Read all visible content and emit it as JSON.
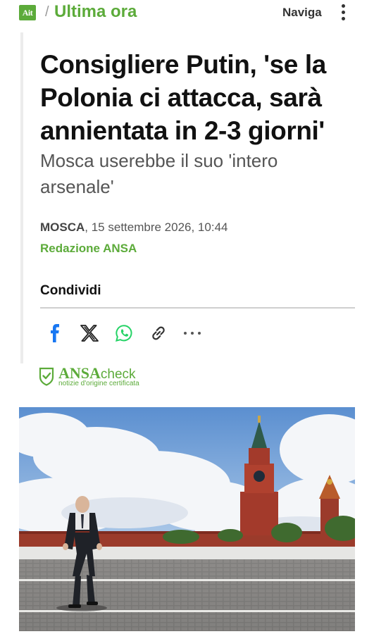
{
  "header": {
    "logo_text": "Ait",
    "separator": "/",
    "section": "Ultima ora",
    "nav_label": "Naviga",
    "menu_icon": "kebab-menu-icon"
  },
  "article": {
    "headline": "Consigliere Putin, 'se la Polonia ci attacca, sarà annientata in 2-3 giorni'",
    "subtitle": "Mosca userebbe il suo 'intero arsenale'",
    "location": "MOSCA",
    "date": ", 15 settembre 2026, 10:44",
    "byline": "Redazione ANSA"
  },
  "share": {
    "label": "Condividi",
    "icons": [
      "facebook-icon",
      "x-icon",
      "whatsapp-icon",
      "link-icon",
      "more-icon"
    ]
  },
  "ansa_check": {
    "brand": "ANSA",
    "brand_suffix": "check",
    "tagline": "notizie d'origine certificata"
  },
  "image": {
    "description_icon": "article-photo"
  },
  "colors": {
    "brand_green": "#5cab3a",
    "facebook": "#1877f2",
    "whatsapp": "#25d366",
    "text": "#111111",
    "muted": "#555555"
  }
}
